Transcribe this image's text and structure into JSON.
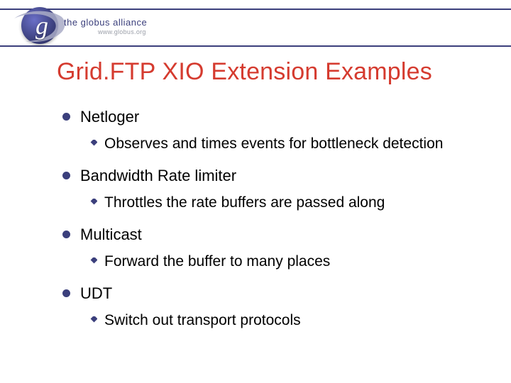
{
  "logo": {
    "g": "g",
    "text": "the globus alliance",
    "url": "www.globus.org"
  },
  "title": "Grid.FTP XIO Extension Examples",
  "bullets": [
    {
      "label": "Netloger",
      "sub": [
        "Observes and times events for bottleneck detection"
      ]
    },
    {
      "label": "Bandwidth Rate limiter",
      "sub": [
        "Throttles the rate buffers are passed along"
      ]
    },
    {
      "label": "Multicast",
      "sub": [
        "Forward the buffer to many places"
      ]
    },
    {
      "label": "UDT",
      "sub": [
        "Switch out transport protocols"
      ]
    }
  ]
}
